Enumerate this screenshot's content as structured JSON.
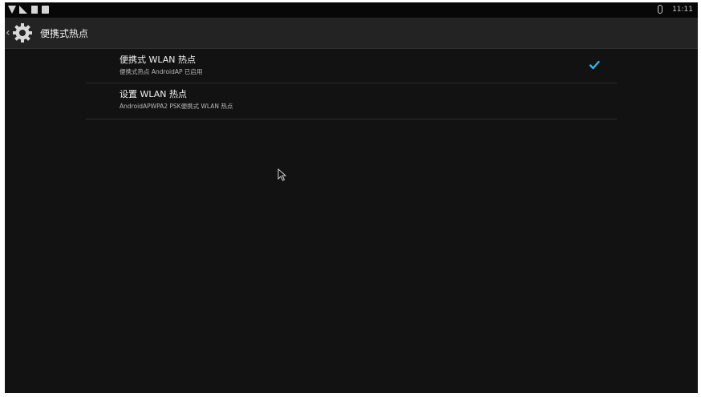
{
  "status_bar": {
    "icons": [
      "wifi-icon",
      "no-sim-icon",
      "sd-card-icon",
      "screenshot-icon"
    ],
    "bluetooth_icon": "bluetooth-icon",
    "time": "11:11"
  },
  "action_bar": {
    "back_glyph": "‹",
    "app_icon": "settings-gear-icon",
    "title": "便携式热点"
  },
  "preferences": [
    {
      "title": "便携式 WLAN 热点",
      "summary": "便携式热点 AndroidAP 已启用",
      "checked": true
    },
    {
      "title": "设置 WLAN 热点",
      "summary": "AndroidAPWPA2 PSK便携式 WLAN 热点"
    }
  ],
  "colors": {
    "background": "#121212",
    "action_bar": "#232323",
    "accent_check": "#33b5e5"
  }
}
